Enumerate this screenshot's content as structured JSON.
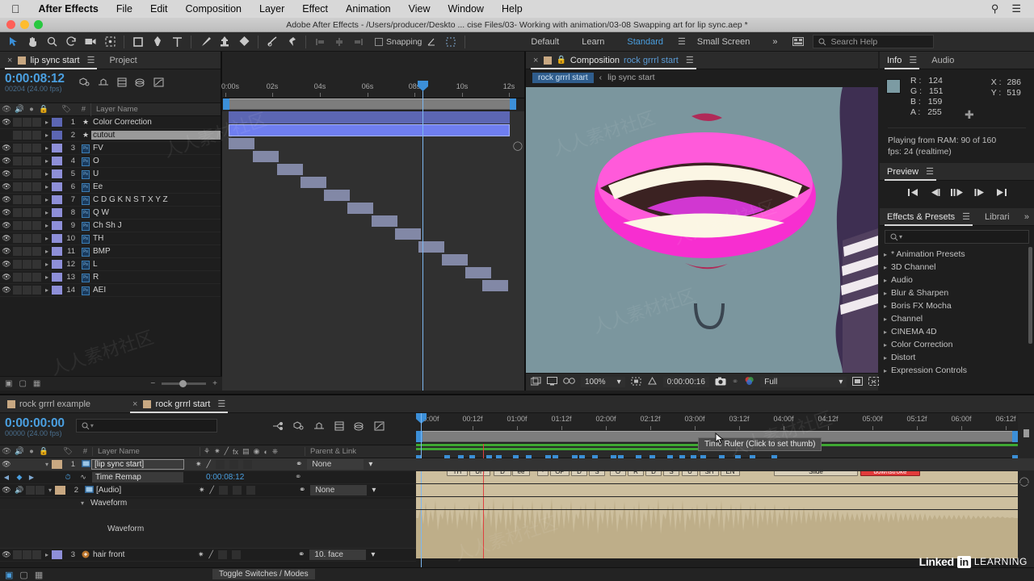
{
  "macmenu": {
    "apple_icon": "apple-icon",
    "items": [
      "After Effects",
      "File",
      "Edit",
      "Composition",
      "Layer",
      "Effect",
      "Animation",
      "View",
      "Window",
      "Help"
    ],
    "right_icons": [
      "search-icon",
      "control-center-icon"
    ]
  },
  "titlebar": {
    "title": "Adobe After Effects - /Users/producer/Deskto ... cise Files/03- Working with animation/03-08 Swapping art for lip sync.aep *"
  },
  "toolbar": {
    "tools": [
      "selection-tool",
      "hand-tool",
      "zoom-tool",
      "rotation-tool",
      "camera-tool",
      "pan-behind-tool",
      "shape-tool",
      "pen-tool",
      "type-tool",
      "brush-tool",
      "clone-stamp-tool",
      "eraser-tool",
      "roto-brush-tool",
      "puppet-pin-tool"
    ],
    "snapping_label": "Snapping",
    "workspaces": [
      "Default",
      "Learn",
      "Standard",
      "Small Screen"
    ],
    "workspace_selected": "Standard",
    "overflow_label": "»",
    "search_help_placeholder": "Search Help"
  },
  "top_timeline": {
    "tabs": [
      {
        "label": "lip sync start",
        "active": true,
        "closable": true
      },
      {
        "label": "Project",
        "active": false,
        "closable": false
      }
    ],
    "timecode": "0:00:08:12",
    "timecode_sub": "00204 (24.00 fps)",
    "columns": {
      "hash": "#",
      "layer_name": "Layer Name"
    },
    "ruler_labels": [
      "0:00s",
      "02s",
      "04s",
      "06s",
      "08s",
      "10s",
      "12s"
    ],
    "layers": [
      {
        "num": "1",
        "name": "Color Correction",
        "icon": "star-icon",
        "selected": false,
        "visible": true
      },
      {
        "num": "2",
        "name": "cutout",
        "icon": "star-icon",
        "selected": true,
        "visible": false
      },
      {
        "num": "3",
        "name": "FV",
        "icon": "ps-icon",
        "selected": false,
        "visible": true
      },
      {
        "num": "4",
        "name": "O",
        "icon": "ps-icon",
        "selected": false,
        "visible": true
      },
      {
        "num": "5",
        "name": "U",
        "icon": "ps-icon",
        "selected": false,
        "visible": true
      },
      {
        "num": "6",
        "name": "Ee",
        "icon": "ps-icon",
        "selected": false,
        "visible": true
      },
      {
        "num": "7",
        "name": "C D G K N S T X Y Z",
        "icon": "ps-icon",
        "selected": false,
        "visible": true
      },
      {
        "num": "8",
        "name": "Q W",
        "icon": "ps-icon",
        "selected": false,
        "visible": true
      },
      {
        "num": "9",
        "name": "Ch Sh J",
        "icon": "ps-icon",
        "selected": false,
        "visible": true
      },
      {
        "num": "10",
        "name": "TH",
        "icon": "ps-icon",
        "selected": false,
        "visible": true
      },
      {
        "num": "11",
        "name": "BMP",
        "icon": "ps-icon",
        "selected": false,
        "visible": true
      },
      {
        "num": "12",
        "name": "L",
        "icon": "ps-icon",
        "selected": false,
        "visible": true
      },
      {
        "num": "13",
        "name": "R",
        "icon": "ps-icon",
        "selected": false,
        "visible": true
      },
      {
        "num": "14",
        "name": "AEI",
        "icon": "ps-icon",
        "selected": false,
        "visible": true
      }
    ]
  },
  "composition": {
    "tab_label": "Composition",
    "tab_comp_name": "rock grrrl start",
    "lock_icon": "lock-icon",
    "breadcrumb_current": "rock grrrl start",
    "breadcrumb_sep": "‹",
    "breadcrumb_parent": "lip sync start",
    "viewer_bg": "#7b969e",
    "lips_color": "#f72ed0",
    "teeth_color": "#fbf6e4",
    "mouth_color": "#3b2222",
    "tongue_color": "#d137d1",
    "hair_color": "#3e2f52",
    "bottom_bar": {
      "zoom": "100%",
      "timecode": "0:00:00:16",
      "quality": "Full",
      "icons": [
        "main-view-icon",
        "monitor-icon",
        "3d-glasses-icon",
        "region-of-interest-icon",
        "transparency-grid-icon",
        "snapshot-icon",
        "show-snapshot-icon",
        "channel-icon",
        "resolution-dropdown",
        "toggle-mask-icon",
        "view-options-icon"
      ]
    }
  },
  "info_panel": {
    "tabs": [
      "Info",
      "Audio"
    ],
    "active_tab": "Info",
    "r_label": "R :",
    "r_value": "124",
    "g_label": "G :",
    "g_value": "151",
    "b_label": "B :",
    "b_value": "159",
    "a_label": "A :",
    "a_value": "255",
    "x_label": "X :",
    "x_value": "286",
    "y_label": "Y :",
    "y_value": "519",
    "status_line1": "Playing from RAM: 90 of 160",
    "status_line2": "fps: 24 (realtime)",
    "swatch_color": "#7c9ba3"
  },
  "preview_panel": {
    "title": "Preview",
    "buttons": [
      "first-frame-icon",
      "previous-frame-icon",
      "play-icon",
      "next-frame-icon",
      "last-frame-icon"
    ]
  },
  "effects_panel": {
    "tabs": [
      "Effects & Presets",
      "Librari"
    ],
    "active_tab": "Effects & Presets",
    "overflow": "»",
    "search_placeholder": "",
    "categories": [
      "* Animation Presets",
      "3D Channel",
      "Audio",
      "Blur & Sharpen",
      "Boris FX Mocha",
      "Channel",
      "CINEMA 4D",
      "Color Correction",
      "Distort",
      "Expression Controls"
    ]
  },
  "bottom_timeline": {
    "tabs": [
      {
        "label": "rock grrrl example",
        "active": false,
        "closable": false
      },
      {
        "label": "rock grrrl start",
        "active": true,
        "closable": true
      }
    ],
    "timecode": "0:00:00:00",
    "timecode_sub": "00000 (24.00 fps)",
    "columns": {
      "hash": "#",
      "layer_name": "Layer Name",
      "parent": "Parent & Link"
    },
    "ruler_labels": [
      "00:00f",
      "00:12f",
      "01:00f",
      "01:12f",
      "02:00f",
      "02:12f",
      "03:00f",
      "03:12f",
      "04:00f",
      "04:12f",
      "05:00f",
      "05:12f",
      "06:00f",
      "06:12f"
    ],
    "layers": [
      {
        "num": "1",
        "name": "[lip sync start]",
        "parent": "None",
        "selected": true,
        "visible": true,
        "audio": false
      },
      {
        "num": "",
        "name": "Time Remap",
        "value": "0:00:08:12",
        "property": true
      },
      {
        "num": "2",
        "name": "[Audio]",
        "parent": "None",
        "selected": false,
        "visible": true,
        "audio": true
      },
      {
        "num": "",
        "name": "Waveform",
        "property": true
      },
      {
        "num": "3",
        "name": "hair front",
        "parent": "10. face",
        "selected": false,
        "visible": true
      }
    ],
    "waveform_label": "Waveform",
    "phonemes": [
      "TH",
      "UH",
      "D",
      "ee",
      "·",
      "OP",
      "D",
      "S",
      "O",
      "R",
      "D",
      "S",
      "U",
      "SH",
      "EN"
    ],
    "marker_slide": "Slide",
    "marker_downstroke": "downstroke",
    "tooltip": "Time Ruler (Click to set thumb)",
    "toggle_switches": "Toggle Switches / Modes"
  },
  "branding": {
    "linkedin": "Linked",
    "in_box": "in",
    "learning": "LEARNING"
  }
}
